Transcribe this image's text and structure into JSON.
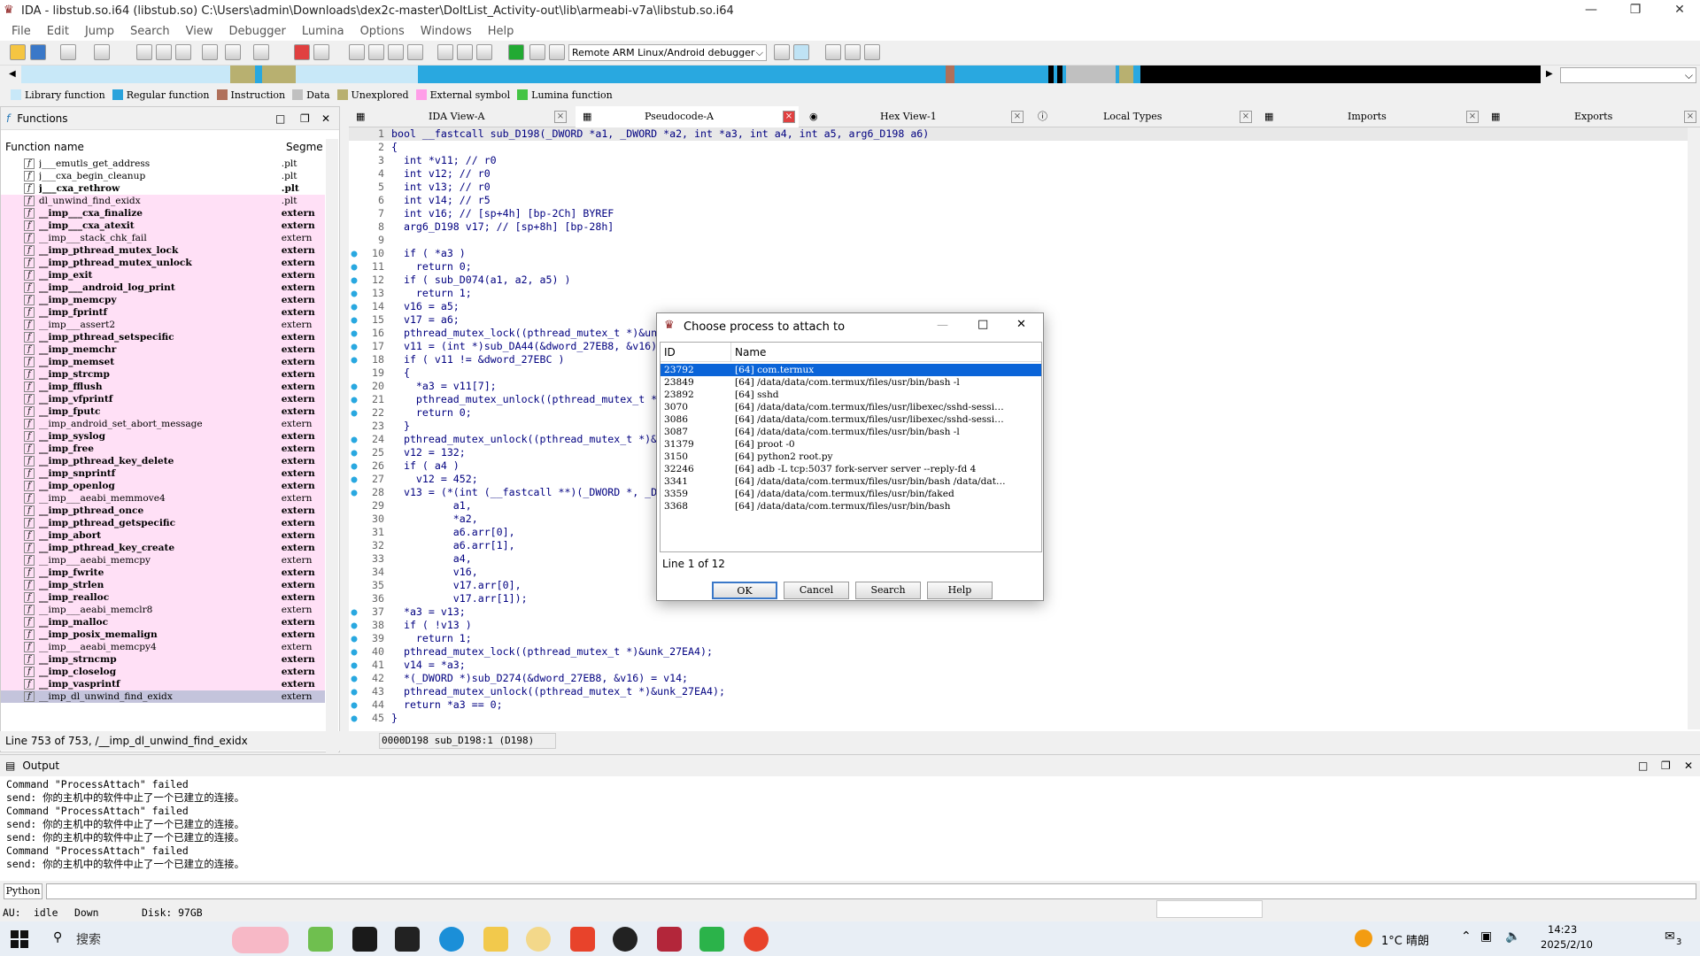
{
  "window": {
    "title": "IDA - libstub.so.i64 (libstub.so) C:\\Users\\admin\\Downloads\\dex2c-master\\DoItList_Activity-out\\lib\\armeabi-v7a\\libstub.so.i64"
  },
  "menu": [
    "File",
    "Edit",
    "Jump",
    "Search",
    "View",
    "Debugger",
    "Lumina",
    "Options",
    "Windows",
    "Help"
  ],
  "toolbar": {
    "debugger": "Remote ARM Linux/Android debugger"
  },
  "legend": [
    {
      "label": "Library function",
      "color": "#c8e8f8"
    },
    {
      "label": "Regular function",
      "color": "#2aa3dc"
    },
    {
      "label": "Instruction",
      "color": "#b0705a"
    },
    {
      "label": "Data",
      "color": "#c0c0c0"
    },
    {
      "label": "Unexplored",
      "color": "#b8b070"
    },
    {
      "label": "External symbol",
      "color": "#ff9ee8"
    },
    {
      "label": "Lumina function",
      "color": "#44c444"
    }
  ],
  "functions": {
    "title": "Functions",
    "col_name": "Function name",
    "col_segment": "Segme",
    "status": "Line 753 of 753, /__imp_dl_unwind_find_exidx",
    "rows": [
      {
        "name": "j___emutls_get_address",
        "seg": ".plt",
        "bold": false,
        "pink": false
      },
      {
        "name": "j___cxa_begin_cleanup",
        "seg": ".plt",
        "bold": false,
        "pink": false
      },
      {
        "name": "j___cxa_rethrow",
        "seg": ".plt",
        "bold": true,
        "pink": false
      },
      {
        "name": "dl_unwind_find_exidx",
        "seg": ".plt",
        "bold": false,
        "pink": true
      },
      {
        "name": "__imp___cxa_finalize",
        "seg": "extern",
        "bold": true,
        "pink": true
      },
      {
        "name": "__imp___cxa_atexit",
        "seg": "extern",
        "bold": true,
        "pink": true
      },
      {
        "name": "__imp___stack_chk_fail",
        "seg": "extern",
        "bold": false,
        "pink": true
      },
      {
        "name": "__imp_pthread_mutex_lock",
        "seg": "extern",
        "bold": true,
        "pink": true
      },
      {
        "name": "__imp_pthread_mutex_unlock",
        "seg": "extern",
        "bold": true,
        "pink": true
      },
      {
        "name": "__imp_exit",
        "seg": "extern",
        "bold": true,
        "pink": true
      },
      {
        "name": "__imp___android_log_print",
        "seg": "extern",
        "bold": true,
        "pink": true
      },
      {
        "name": "__imp_memcpy",
        "seg": "extern",
        "bold": true,
        "pink": true
      },
      {
        "name": "__imp_fprintf",
        "seg": "extern",
        "bold": true,
        "pink": true
      },
      {
        "name": "__imp___assert2",
        "seg": "extern",
        "bold": false,
        "pink": true
      },
      {
        "name": "__imp_pthread_setspecific",
        "seg": "extern",
        "bold": true,
        "pink": true
      },
      {
        "name": "__imp_memchr",
        "seg": "extern",
        "bold": true,
        "pink": true
      },
      {
        "name": "__imp_memset",
        "seg": "extern",
        "bold": true,
        "pink": true
      },
      {
        "name": "__imp_strcmp",
        "seg": "extern",
        "bold": true,
        "pink": true
      },
      {
        "name": "__imp_fflush",
        "seg": "extern",
        "bold": true,
        "pink": true
      },
      {
        "name": "__imp_vfprintf",
        "seg": "extern",
        "bold": true,
        "pink": true
      },
      {
        "name": "__imp_fputc",
        "seg": "extern",
        "bold": true,
        "pink": true
      },
      {
        "name": "__imp_android_set_abort_message",
        "seg": "extern",
        "bold": false,
        "pink": true
      },
      {
        "name": "__imp_syslog",
        "seg": "extern",
        "bold": true,
        "pink": true
      },
      {
        "name": "__imp_free",
        "seg": "extern",
        "bold": true,
        "pink": true
      },
      {
        "name": "__imp_pthread_key_delete",
        "seg": "extern",
        "bold": true,
        "pink": true
      },
      {
        "name": "__imp_snprintf",
        "seg": "extern",
        "bold": true,
        "pink": true
      },
      {
        "name": "__imp_openlog",
        "seg": "extern",
        "bold": true,
        "pink": true
      },
      {
        "name": "__imp___aeabi_memmove4",
        "seg": "extern",
        "bold": false,
        "pink": true
      },
      {
        "name": "__imp_pthread_once",
        "seg": "extern",
        "bold": true,
        "pink": true
      },
      {
        "name": "__imp_pthread_getspecific",
        "seg": "extern",
        "bold": true,
        "pink": true
      },
      {
        "name": "__imp_abort",
        "seg": "extern",
        "bold": true,
        "pink": true
      },
      {
        "name": "__imp_pthread_key_create",
        "seg": "extern",
        "bold": true,
        "pink": true
      },
      {
        "name": "__imp___aeabi_memcpy",
        "seg": "extern",
        "bold": false,
        "pink": true
      },
      {
        "name": "__imp_fwrite",
        "seg": "extern",
        "bold": true,
        "pink": true
      },
      {
        "name": "__imp_strlen",
        "seg": "extern",
        "bold": true,
        "pink": true
      },
      {
        "name": "__imp_realloc",
        "seg": "extern",
        "bold": true,
        "pink": true
      },
      {
        "name": "__imp___aeabi_memclr8",
        "seg": "extern",
        "bold": false,
        "pink": true
      },
      {
        "name": "__imp_malloc",
        "seg": "extern",
        "bold": true,
        "pink": true
      },
      {
        "name": "__imp_posix_memalign",
        "seg": "extern",
        "bold": true,
        "pink": true
      },
      {
        "name": "__imp___aeabi_memcpy4",
        "seg": "extern",
        "bold": false,
        "pink": true
      },
      {
        "name": "__imp_strncmp",
        "seg": "extern",
        "bold": true,
        "pink": true
      },
      {
        "name": "__imp_closelog",
        "seg": "extern",
        "bold": true,
        "pink": true
      },
      {
        "name": "__imp_vasprintf",
        "seg": "extern",
        "bold": true,
        "pink": true
      },
      {
        "name": "__imp_dl_unwind_find_exidx",
        "seg": "extern",
        "bold": false,
        "pink": true,
        "selected": true
      }
    ]
  },
  "tabs": [
    {
      "label": "IDA View-A"
    },
    {
      "label": "Pseudocode-A"
    },
    {
      "label": "Hex View-1"
    },
    {
      "label": "Local Types"
    },
    {
      "label": "Imports"
    },
    {
      "label": "Exports"
    }
  ],
  "code": {
    "status": "0000D198 sub_D198:1 (D198)",
    "lines": [
      {
        "n": "1",
        "dot": false,
        "text": "bool __fastcall sub_D198(_DWORD *a1, _DWORD *a2, int *a3, int a4, int a5, arg6_D198 a6)"
      },
      {
        "n": "2",
        "dot": false,
        "text": "{"
      },
      {
        "n": "3",
        "dot": false,
        "text": "  int *v11; // r0"
      },
      {
        "n": "4",
        "dot": false,
        "text": "  int v12; // r0"
      },
      {
        "n": "5",
        "dot": false,
        "text": "  int v13; // r0"
      },
      {
        "n": "6",
        "dot": false,
        "text": "  int v14; // r5"
      },
      {
        "n": "7",
        "dot": false,
        "text": "  int v16; // [sp+4h] [bp-2Ch] BYREF"
      },
      {
        "n": "8",
        "dot": false,
        "text": "  arg6_D198 v17; // [sp+8h] [bp-28h]"
      },
      {
        "n": "9",
        "dot": false,
        "text": ""
      },
      {
        "n": "10",
        "dot": true,
        "text": "  if ( *a3 )"
      },
      {
        "n": "11",
        "dot": true,
        "text": "    return 0;"
      },
      {
        "n": "12",
        "dot": true,
        "text": "  if ( sub_D074(a1, a2, a5) )"
      },
      {
        "n": "13",
        "dot": true,
        "text": "    return 1;"
      },
      {
        "n": "14",
        "dot": true,
        "text": "  v16 = a5;"
      },
      {
        "n": "15",
        "dot": true,
        "text": "  v17 = a6;"
      },
      {
        "n": "16",
        "dot": true,
        "text": "  pthread_mutex_lock((pthread_mutex_t *)&unk"
      },
      {
        "n": "17",
        "dot": true,
        "text": "  v11 = (int *)sub_DA44(&dword_27EB8, &v16);"
      },
      {
        "n": "18",
        "dot": true,
        "text": "  if ( v11 != &dword_27EBC )"
      },
      {
        "n": "19",
        "dot": false,
        "text": "  {"
      },
      {
        "n": "20",
        "dot": true,
        "text": "    *a3 = v11[7];"
      },
      {
        "n": "21",
        "dot": true,
        "text": "    pthread_mutex_unlock((pthread_mutex_t *)&"
      },
      {
        "n": "22",
        "dot": true,
        "text": "    return 0;"
      },
      {
        "n": "23",
        "dot": false,
        "text": "  }"
      },
      {
        "n": "24",
        "dot": true,
        "text": "  pthread_mutex_unlock((pthread_mutex_t *)&un"
      },
      {
        "n": "25",
        "dot": true,
        "text": "  v12 = 132;"
      },
      {
        "n": "26",
        "dot": true,
        "text": "  if ( a4 )"
      },
      {
        "n": "27",
        "dot": true,
        "text": "    v12 = 452;"
      },
      {
        "n": "28",
        "dot": true,
        "text": "  v13 = (*(int (__fastcall **)(_DWORD *, _DW"
      },
      {
        "n": "29",
        "dot": false,
        "text": "          a1,"
      },
      {
        "n": "30",
        "dot": false,
        "text": "          *a2,"
      },
      {
        "n": "31",
        "dot": false,
        "text": "          a6.arr[0],"
      },
      {
        "n": "32",
        "dot": false,
        "text": "          a6.arr[1],"
      },
      {
        "n": "33",
        "dot": false,
        "text": "          a4,"
      },
      {
        "n": "34",
        "dot": false,
        "text": "          v16,"
      },
      {
        "n": "35",
        "dot": false,
        "text": "          v17.arr[0],"
      },
      {
        "n": "36",
        "dot": false,
        "text": "          v17.arr[1]);"
      },
      {
        "n": "37",
        "dot": true,
        "text": "  *a3 = v13;"
      },
      {
        "n": "38",
        "dot": true,
        "text": "  if ( !v13 )"
      },
      {
        "n": "39",
        "dot": true,
        "text": "    return 1;"
      },
      {
        "n": "40",
        "dot": true,
        "text": "  pthread_mutex_lock((pthread_mutex_t *)&unk_27EA4);"
      },
      {
        "n": "41",
        "dot": true,
        "text": "  v14 = *a3;"
      },
      {
        "n": "42",
        "dot": true,
        "text": "  *(_DWORD *)sub_D274(&dword_27EB8, &v16) = v14;"
      },
      {
        "n": "43",
        "dot": true,
        "text": "  pthread_mutex_unlock((pthread_mutex_t *)&unk_27EA4);"
      },
      {
        "n": "44",
        "dot": true,
        "text": "  return *a3 == 0;"
      },
      {
        "n": "45",
        "dot": true,
        "text": "}"
      }
    ]
  },
  "dialog": {
    "title": "Choose process to attach to",
    "col_id": "ID",
    "col_name": "Name",
    "status": "Line 1 of 12",
    "ok": "OK",
    "cancel": "Cancel",
    "search": "Search",
    "help": "Help",
    "rows": [
      {
        "id": "23792",
        "name": "[64] com.termux",
        "selected": true
      },
      {
        "id": "23849",
        "name": "[64] /data/data/com.termux/files/usr/bin/bash -l"
      },
      {
        "id": "23892",
        "name": "[64] sshd"
      },
      {
        "id": "3070",
        "name": "[64] /data/data/com.termux/files/usr/libexec/sshd-sessi…"
      },
      {
        "id": "3086",
        "name": "[64] /data/data/com.termux/files/usr/libexec/sshd-sessi…"
      },
      {
        "id": "3087",
        "name": "[64] /data/data/com.termux/files/usr/bin/bash -l"
      },
      {
        "id": "31379",
        "name": "[64] proot -0"
      },
      {
        "id": "3150",
        "name": "[64] python2 root.py"
      },
      {
        "id": "32246",
        "name": "[64] adb -L tcp:5037 fork-server server --reply-fd 4"
      },
      {
        "id": "3341",
        "name": "[64] /data/data/com.termux/files/usr/bin/bash /data/dat…"
      },
      {
        "id": "3359",
        "name": "[64] /data/data/com.termux/files/usr/bin/faked"
      },
      {
        "id": "3368",
        "name": "[64] /data/data/com.termux/files/usr/bin/bash"
      }
    ]
  },
  "output": {
    "title": "Output",
    "lines": [
      "Command \"ProcessAttach\" failed",
      "send: 你的主机中的软件中止了一个已建立的连接。",
      "Command \"ProcessAttach\" failed",
      "send: 你的主机中的软件中止了一个已建立的连接。",
      "send: 你的主机中的软件中止了一个已建立的连接。",
      "Command \"ProcessAttach\" failed",
      "send: 你的主机中的软件中止了一个已建立的连接。"
    ],
    "python_label": "Python"
  },
  "statusbar": {
    "au": "AU:",
    "state": "idle",
    "dir": "Down",
    "disk": "Disk: 97GB"
  },
  "taskbar": {
    "search": "搜索",
    "weather": "1°C 晴朗",
    "time": "14:23",
    "date": "2025/2/10",
    "badge": "3"
  }
}
